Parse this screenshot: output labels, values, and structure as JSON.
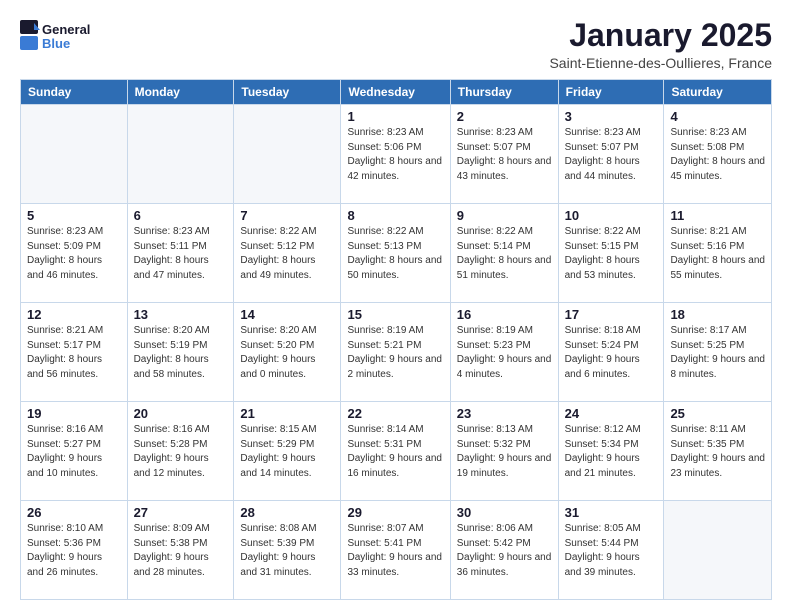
{
  "header": {
    "logo_general": "General",
    "logo_blue": "Blue",
    "title": "January 2025",
    "subtitle": "Saint-Etienne-des-Oullieres, France"
  },
  "weekdays": [
    "Sunday",
    "Monday",
    "Tuesday",
    "Wednesday",
    "Thursday",
    "Friday",
    "Saturday"
  ],
  "weeks": [
    [
      {
        "day": "",
        "info": ""
      },
      {
        "day": "",
        "info": ""
      },
      {
        "day": "",
        "info": ""
      },
      {
        "day": "1",
        "info": "Sunrise: 8:23 AM\nSunset: 5:06 PM\nDaylight: 8 hours and 42 minutes."
      },
      {
        "day": "2",
        "info": "Sunrise: 8:23 AM\nSunset: 5:07 PM\nDaylight: 8 hours and 43 minutes."
      },
      {
        "day": "3",
        "info": "Sunrise: 8:23 AM\nSunset: 5:07 PM\nDaylight: 8 hours and 44 minutes."
      },
      {
        "day": "4",
        "info": "Sunrise: 8:23 AM\nSunset: 5:08 PM\nDaylight: 8 hours and 45 minutes."
      }
    ],
    [
      {
        "day": "5",
        "info": "Sunrise: 8:23 AM\nSunset: 5:09 PM\nDaylight: 8 hours and 46 minutes."
      },
      {
        "day": "6",
        "info": "Sunrise: 8:23 AM\nSunset: 5:11 PM\nDaylight: 8 hours and 47 minutes."
      },
      {
        "day": "7",
        "info": "Sunrise: 8:22 AM\nSunset: 5:12 PM\nDaylight: 8 hours and 49 minutes."
      },
      {
        "day": "8",
        "info": "Sunrise: 8:22 AM\nSunset: 5:13 PM\nDaylight: 8 hours and 50 minutes."
      },
      {
        "day": "9",
        "info": "Sunrise: 8:22 AM\nSunset: 5:14 PM\nDaylight: 8 hours and 51 minutes."
      },
      {
        "day": "10",
        "info": "Sunrise: 8:22 AM\nSunset: 5:15 PM\nDaylight: 8 hours and 53 minutes."
      },
      {
        "day": "11",
        "info": "Sunrise: 8:21 AM\nSunset: 5:16 PM\nDaylight: 8 hours and 55 minutes."
      }
    ],
    [
      {
        "day": "12",
        "info": "Sunrise: 8:21 AM\nSunset: 5:17 PM\nDaylight: 8 hours and 56 minutes."
      },
      {
        "day": "13",
        "info": "Sunrise: 8:20 AM\nSunset: 5:19 PM\nDaylight: 8 hours and 58 minutes."
      },
      {
        "day": "14",
        "info": "Sunrise: 8:20 AM\nSunset: 5:20 PM\nDaylight: 9 hours and 0 minutes."
      },
      {
        "day": "15",
        "info": "Sunrise: 8:19 AM\nSunset: 5:21 PM\nDaylight: 9 hours and 2 minutes."
      },
      {
        "day": "16",
        "info": "Sunrise: 8:19 AM\nSunset: 5:23 PM\nDaylight: 9 hours and 4 minutes."
      },
      {
        "day": "17",
        "info": "Sunrise: 8:18 AM\nSunset: 5:24 PM\nDaylight: 9 hours and 6 minutes."
      },
      {
        "day": "18",
        "info": "Sunrise: 8:17 AM\nSunset: 5:25 PM\nDaylight: 9 hours and 8 minutes."
      }
    ],
    [
      {
        "day": "19",
        "info": "Sunrise: 8:16 AM\nSunset: 5:27 PM\nDaylight: 9 hours and 10 minutes."
      },
      {
        "day": "20",
        "info": "Sunrise: 8:16 AM\nSunset: 5:28 PM\nDaylight: 9 hours and 12 minutes."
      },
      {
        "day": "21",
        "info": "Sunrise: 8:15 AM\nSunset: 5:29 PM\nDaylight: 9 hours and 14 minutes."
      },
      {
        "day": "22",
        "info": "Sunrise: 8:14 AM\nSunset: 5:31 PM\nDaylight: 9 hours and 16 minutes."
      },
      {
        "day": "23",
        "info": "Sunrise: 8:13 AM\nSunset: 5:32 PM\nDaylight: 9 hours and 19 minutes."
      },
      {
        "day": "24",
        "info": "Sunrise: 8:12 AM\nSunset: 5:34 PM\nDaylight: 9 hours and 21 minutes."
      },
      {
        "day": "25",
        "info": "Sunrise: 8:11 AM\nSunset: 5:35 PM\nDaylight: 9 hours and 23 minutes."
      }
    ],
    [
      {
        "day": "26",
        "info": "Sunrise: 8:10 AM\nSunset: 5:36 PM\nDaylight: 9 hours and 26 minutes."
      },
      {
        "day": "27",
        "info": "Sunrise: 8:09 AM\nSunset: 5:38 PM\nDaylight: 9 hours and 28 minutes."
      },
      {
        "day": "28",
        "info": "Sunrise: 8:08 AM\nSunset: 5:39 PM\nDaylight: 9 hours and 31 minutes."
      },
      {
        "day": "29",
        "info": "Sunrise: 8:07 AM\nSunset: 5:41 PM\nDaylight: 9 hours and 33 minutes."
      },
      {
        "day": "30",
        "info": "Sunrise: 8:06 AM\nSunset: 5:42 PM\nDaylight: 9 hours and 36 minutes."
      },
      {
        "day": "31",
        "info": "Sunrise: 8:05 AM\nSunset: 5:44 PM\nDaylight: 9 hours and 39 minutes."
      },
      {
        "day": "",
        "info": ""
      }
    ]
  ]
}
